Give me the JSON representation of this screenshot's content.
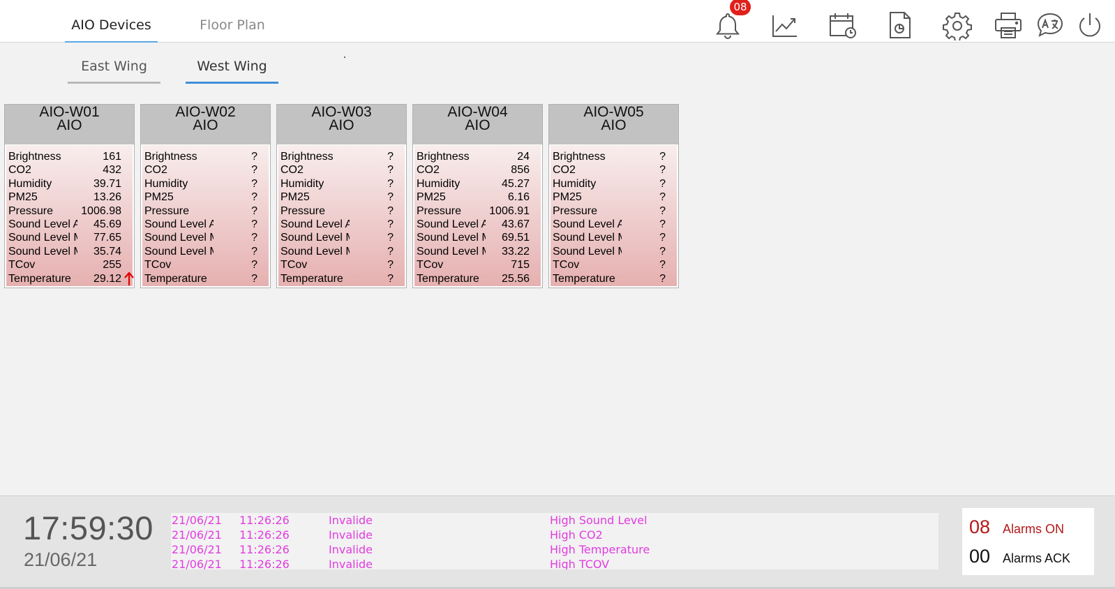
{
  "nav": {
    "tabs": [
      {
        "label": "AIO Devices",
        "active": true
      },
      {
        "label": "Floor Plan",
        "active": false
      }
    ],
    "wings": [
      {
        "label": "East Wing",
        "active": false
      },
      {
        "label": "West Wing",
        "active": true
      }
    ]
  },
  "toolbar": {
    "notification_count": "08",
    "icons": [
      "bell-icon",
      "trend-chart-icon",
      "calendar-clock-icon",
      "report-document-icon",
      "gear-icon",
      "printer-icon",
      "translate-icon",
      "power-icon"
    ]
  },
  "devices": [
    {
      "name": "AIO-W01",
      "type": "AIO",
      "readings": [
        {
          "label": "Brightness",
          "value": "161"
        },
        {
          "label": "CO2",
          "value": "432"
        },
        {
          "label": "Humidity",
          "value": "39.71"
        },
        {
          "label": "PM25",
          "value": "13.26"
        },
        {
          "label": "Pressure",
          "value": "1006.98"
        },
        {
          "label": "Sound Level A",
          "value": "45.69"
        },
        {
          "label": "Sound Level Max",
          "value": "77.65"
        },
        {
          "label": "Sound Level Min",
          "value": "35.74"
        },
        {
          "label": "TCov",
          "value": "255"
        },
        {
          "label": "Temperature",
          "value": "29.12",
          "trend": "up-arrow-icon"
        }
      ]
    },
    {
      "name": "AIO-W02",
      "type": "AIO",
      "readings": [
        {
          "label": "Brightness",
          "value": "?"
        },
        {
          "label": "CO2",
          "value": "?"
        },
        {
          "label": "Humidity",
          "value": "?"
        },
        {
          "label": "PM25",
          "value": "?"
        },
        {
          "label": "Pressure",
          "value": "?"
        },
        {
          "label": "Sound Level A",
          "value": "?"
        },
        {
          "label": "Sound Level Max",
          "value": "?"
        },
        {
          "label": "Sound Level Min",
          "value": "?"
        },
        {
          "label": "TCov",
          "value": "?"
        },
        {
          "label": "Temperature",
          "value": "?"
        }
      ]
    },
    {
      "name": "AIO-W03",
      "type": "AIO",
      "readings": [
        {
          "label": "Brightness",
          "value": "?"
        },
        {
          "label": "CO2",
          "value": "?"
        },
        {
          "label": "Humidity",
          "value": "?"
        },
        {
          "label": "PM25",
          "value": "?"
        },
        {
          "label": "Pressure",
          "value": "?"
        },
        {
          "label": "Sound Level A",
          "value": "?"
        },
        {
          "label": "Sound Level Max",
          "value": "?"
        },
        {
          "label": "Sound Level Min",
          "value": "?"
        },
        {
          "label": "TCov",
          "value": "?"
        },
        {
          "label": "Temperature",
          "value": "?"
        }
      ]
    },
    {
      "name": "AIO-W04",
      "type": "AIO",
      "readings": [
        {
          "label": "Brightness",
          "value": "24"
        },
        {
          "label": "CO2",
          "value": "856"
        },
        {
          "label": "Humidity",
          "value": "45.27"
        },
        {
          "label": "PM25",
          "value": "6.16"
        },
        {
          "label": "Pressure",
          "value": "1006.91"
        },
        {
          "label": "Sound Level A",
          "value": "43.67"
        },
        {
          "label": "Sound Level Max",
          "value": "69.51"
        },
        {
          "label": "Sound Level Min",
          "value": "33.22"
        },
        {
          "label": "TCov",
          "value": "715"
        },
        {
          "label": "Temperature",
          "value": "25.56"
        }
      ]
    },
    {
      "name": "AIO-W05",
      "type": "AIO",
      "readings": [
        {
          "label": "Brightness",
          "value": "?"
        },
        {
          "label": "CO2",
          "value": "?"
        },
        {
          "label": "Humidity",
          "value": "?"
        },
        {
          "label": "PM25",
          "value": "?"
        },
        {
          "label": "Pressure",
          "value": "?"
        },
        {
          "label": "Sound Level A",
          "value": "?"
        },
        {
          "label": "Sound Level Max",
          "value": "?"
        },
        {
          "label": "Sound Level Min",
          "value": "?"
        },
        {
          "label": "TCov",
          "value": "?"
        },
        {
          "label": "Temperature",
          "value": "?"
        }
      ]
    }
  ],
  "status": {
    "time": "17:59:30",
    "date": "21/06/21",
    "alarms": [
      {
        "date": "21/06/21",
        "time": "11:26:26",
        "state": "Invalide",
        "message": "High Sound Level"
      },
      {
        "date": "21/06/21",
        "time": "11:26:26",
        "state": "Invalide",
        "message": "High CO2"
      },
      {
        "date": "21/06/21",
        "time": "11:26:26",
        "state": "Invalide",
        "message": "High Temperature"
      },
      {
        "date": "21/06/21",
        "time": "11:26:26",
        "state": "Invalide",
        "message": "High TCOV"
      }
    ],
    "alarms_on_count": "08",
    "alarms_on_label": "Alarms ON",
    "alarms_ack_count": "00",
    "alarms_ack_label": "Alarms ACK"
  },
  "colors": {
    "accent": "#3e8fd8",
    "badge": "#e0201b",
    "alarm_text": "#e23ce0",
    "alarm_on": "#b51818",
    "trend_up": "#e00000"
  }
}
